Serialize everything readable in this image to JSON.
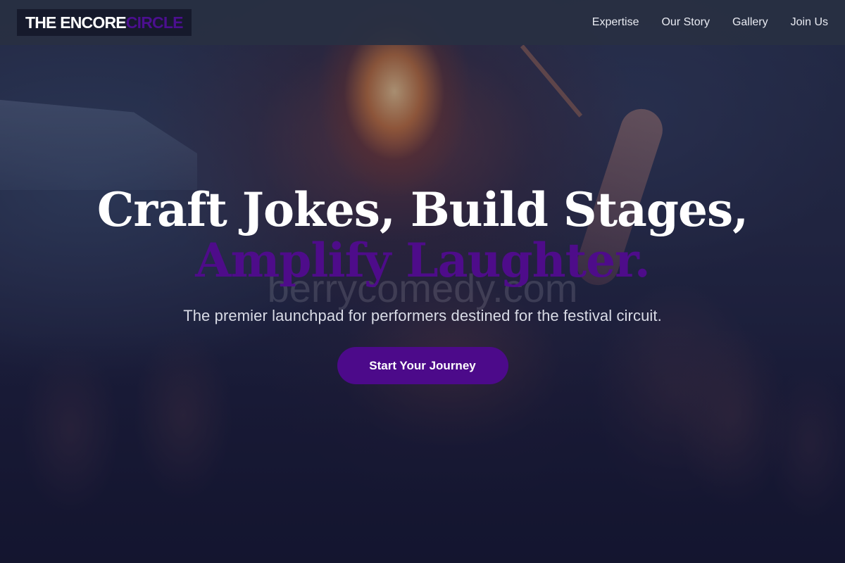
{
  "nav": {
    "logo_main": "THE ENCORE",
    "logo_accent": "CIRCLE",
    "links": [
      "Expertise",
      "Our Story",
      "Gallery",
      "Join Us"
    ]
  },
  "hero": {
    "title_line_1": "Craft Jokes, Build Stages,",
    "title_line_2": "Amplify Laughter.",
    "watermark": "berrycomedy.com",
    "subtitle": "The premier launchpad for performers destined for the festival circuit.",
    "cta_label": "Start Your Journey",
    "background_image": "fire-performer-crowd"
  },
  "colors": {
    "accent": "#4c0a8a",
    "nav_background": "#283042",
    "logo_background": "#161a2c",
    "text_primary": "#ffffff"
  }
}
